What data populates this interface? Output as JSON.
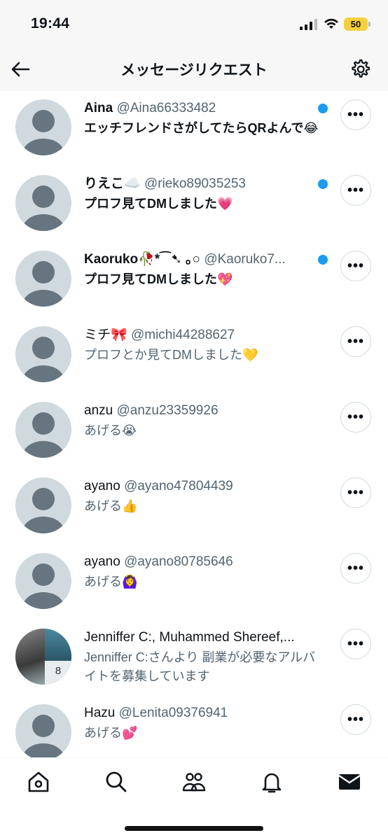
{
  "status_bar": {
    "time": "19:44",
    "battery": "50"
  },
  "header": {
    "title": "メッセージリクエスト"
  },
  "requests": [
    {
      "name": "Aina",
      "handle": "@Aina66333482",
      "message": "エッチフレンドさがしてたらQRよんで😂",
      "unread": true
    },
    {
      "name": "りえこ☁️",
      "handle": "@rieko89035253",
      "message": "プロフ見てDMしました💗",
      "unread": true
    },
    {
      "name": "Kaoruko🥀*⁀➷ ｡○",
      "handle": "@Kaoruko7...",
      "message": "プロフ見てDMしました💖",
      "unread": true
    },
    {
      "name": "ミチ🎀",
      "handle": "@michi44288627",
      "message": "プロフとか見てDMしました💛",
      "unread": false
    },
    {
      "name": "anzu",
      "handle": "@anzu23359926",
      "message": "あげる😭",
      "unread": false
    },
    {
      "name": "ayano",
      "handle": "@ayano47804439",
      "message": "あげる👍",
      "unread": false
    },
    {
      "name": "ayano",
      "handle": "@ayano80785646",
      "message": "あげる🙆‍♀️",
      "unread": false
    },
    {
      "name": "Jenniffer C:, Muhammed Shereef,...",
      "handle": "",
      "message": "Jenniffer C:さんより 副業が必要なアルバイトを募集しています",
      "unread": false,
      "group_count": "8"
    },
    {
      "name": "Hazu",
      "handle": "@Lenita09376941",
      "message": "あげる💕",
      "unread": false
    }
  ],
  "more_label": "•••",
  "tabs": [
    "home-icon",
    "search-icon",
    "communities-icon",
    "bell-icon",
    "mail-icon"
  ]
}
